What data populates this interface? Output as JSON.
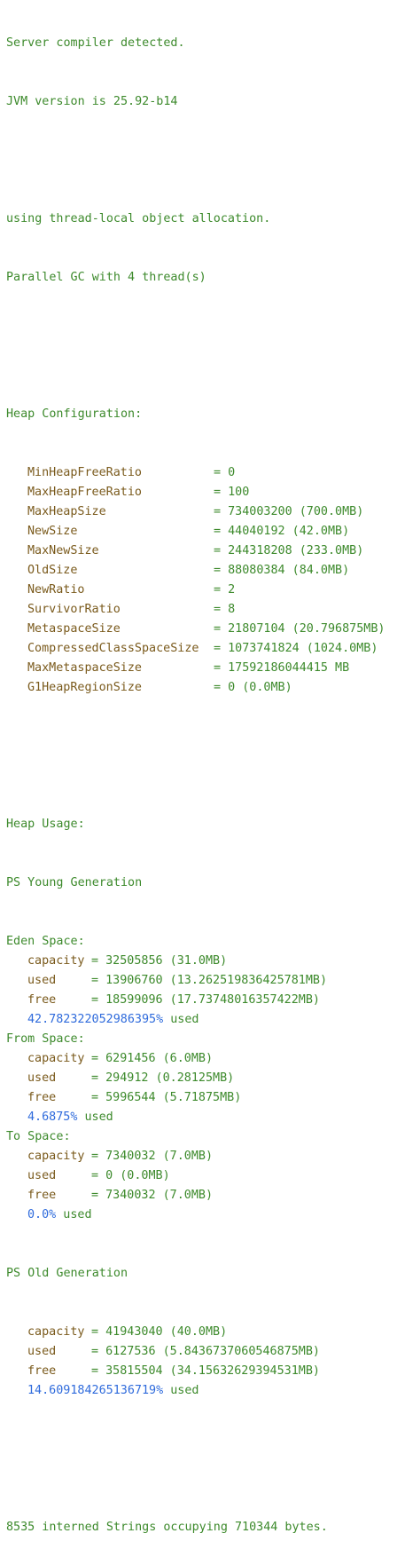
{
  "intro": [
    "Server compiler detected.",
    "JVM version is 25.92-b14"
  ],
  "alloc": [
    "using thread-local object allocation.",
    "Parallel GC with 4 thread(s)"
  ],
  "heap_config": {
    "title": "Heap Configuration:",
    "rows": [
      {
        "key": "MinHeapFreeRatio",
        "value": "0"
      },
      {
        "key": "MaxHeapFreeRatio",
        "value": "100"
      },
      {
        "key": "MaxHeapSize",
        "value": "734003200 (700.0MB)"
      },
      {
        "key": "NewSize",
        "value": "44040192 (42.0MB)"
      },
      {
        "key": "MaxNewSize",
        "value": "244318208 (233.0MB)"
      },
      {
        "key": "OldSize",
        "value": "88080384 (84.0MB)"
      },
      {
        "key": "NewRatio",
        "value": "2"
      },
      {
        "key": "SurvivorRatio",
        "value": "8"
      },
      {
        "key": "MetaspaceSize",
        "value": "21807104 (20.796875MB)"
      },
      {
        "key": "CompressedClassSpaceSize",
        "value": "1073741824 (1024.0MB)"
      },
      {
        "key": "MaxMetaspaceSize",
        "value": "17592186044415 MB"
      },
      {
        "key": "G1HeapRegionSize",
        "value": "0 (0.0MB)"
      }
    ]
  },
  "heap_usage": {
    "title": "Heap Usage:",
    "young_gen": "PS Young Generation",
    "spaces": [
      {
        "name": "Eden Space:",
        "capacity": "32505856 (31.0MB)",
        "used": "13906760 (13.262519836425781MB)",
        "free": "18599096 (17.73748016357422MB)",
        "pct": "42.782322052986395%",
        "pct_suffix": " used"
      },
      {
        "name": "From Space:",
        "capacity": "6291456 (6.0MB)",
        "used": "294912 (0.28125MB)",
        "free": "5996544 (5.71875MB)",
        "pct": "4.6875%",
        "pct_suffix": " used"
      },
      {
        "name": "To Space:",
        "capacity": "7340032 (7.0MB)",
        "used": "0 (0.0MB)",
        "free": "7340032 (7.0MB)",
        "pct": "0.0%",
        "pct_suffix": " used"
      }
    ],
    "old_gen": {
      "name": "PS Old Generation",
      "capacity": "41943040 (40.0MB)",
      "used": "6127536 (5.8436737060546875MB)",
      "free": "35815504 (34.15632629394531MB)",
      "pct": "14.609184265136719%",
      "pct_suffix": " used"
    },
    "labels": {
      "capacity": "capacity",
      "used": "used",
      "free": "free",
      "eq": "= "
    }
  },
  "footer": "8535 interned Strings occupying 710344 bytes.",
  "colors": {
    "text_green": "#3d8a2c",
    "key_brown": "#7a5a1c",
    "percent_blue": "#2f6bdc",
    "background": "#ffffff"
  }
}
